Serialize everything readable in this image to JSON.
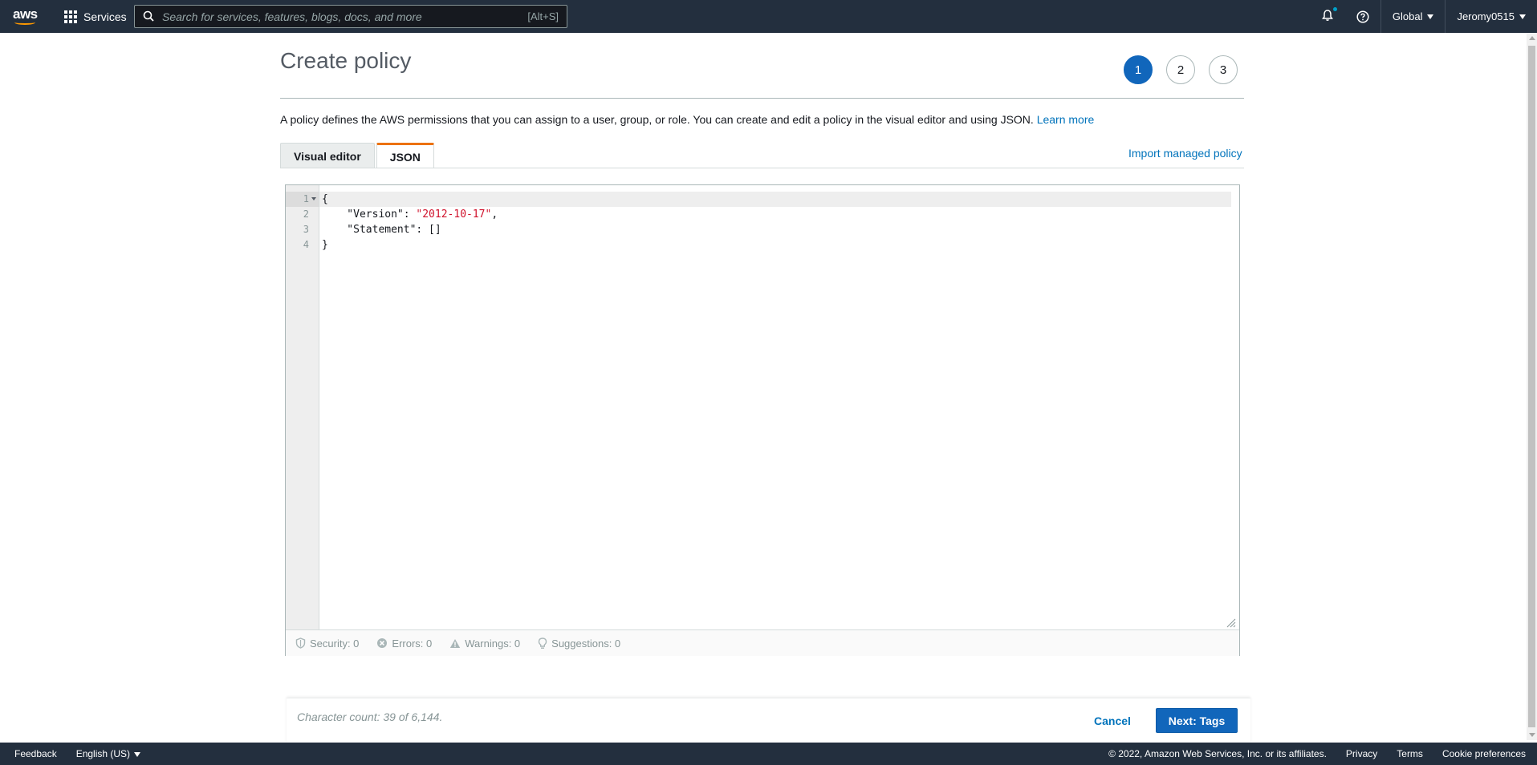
{
  "topnav": {
    "logo_text": "aws",
    "services_label": "Services",
    "search_placeholder": "Search for services, features, blogs, docs, and more",
    "search_shortcut": "[Alt+S]",
    "region": "Global",
    "account": "Jeromy0515"
  },
  "page": {
    "title": "Create policy",
    "steps": [
      "1",
      "2",
      "3"
    ],
    "active_step": 1,
    "description": "A policy defines the AWS permissions that you can assign to a user, group, or role. You can create and edit a policy in the visual editor and using JSON.",
    "learn_more": "Learn more",
    "tabs": [
      {
        "label": "Visual editor",
        "active": false
      },
      {
        "label": "JSON",
        "active": true
      }
    ],
    "import_link": "Import managed policy"
  },
  "editor": {
    "line_numbers": [
      "1",
      "2",
      "3",
      "4"
    ],
    "lines": [
      {
        "before": "{",
        "string": "",
        "after": ""
      },
      {
        "before": "    \"Version\": ",
        "string": "\"2012-10-17\"",
        "after": ","
      },
      {
        "before": "    \"Statement\": []",
        "string": "",
        "after": ""
      },
      {
        "before": "}",
        "string": "",
        "after": ""
      }
    ],
    "status": {
      "security": "Security: 0",
      "errors": "Errors: 0",
      "warnings": "Warnings: 0",
      "suggestions": "Suggestions: 0"
    }
  },
  "actions": {
    "char_count": "Character count: 39 of 6,144.",
    "cancel": "Cancel",
    "next": "Next: Tags"
  },
  "footer": {
    "feedback": "Feedback",
    "language": "English (US)",
    "copyright": "© 2022, Amazon Web Services, Inc. or its affiliates.",
    "privacy": "Privacy",
    "terms": "Terms",
    "cookies": "Cookie preferences"
  },
  "colors": {
    "nav_bg": "#232f3e",
    "primary": "#1166bb",
    "link": "#0073bb",
    "tab_accent": "#ec7211",
    "json_string": "#d0112b",
    "notification_dot": "#00a1c9"
  },
  "icons": {
    "services": "grid-icon",
    "search": "search-icon",
    "notifications": "bell-icon",
    "help": "help-icon",
    "security": "shield-icon",
    "errors": "error-icon",
    "warnings": "warning-icon",
    "suggestions": "lightbulb-icon"
  }
}
